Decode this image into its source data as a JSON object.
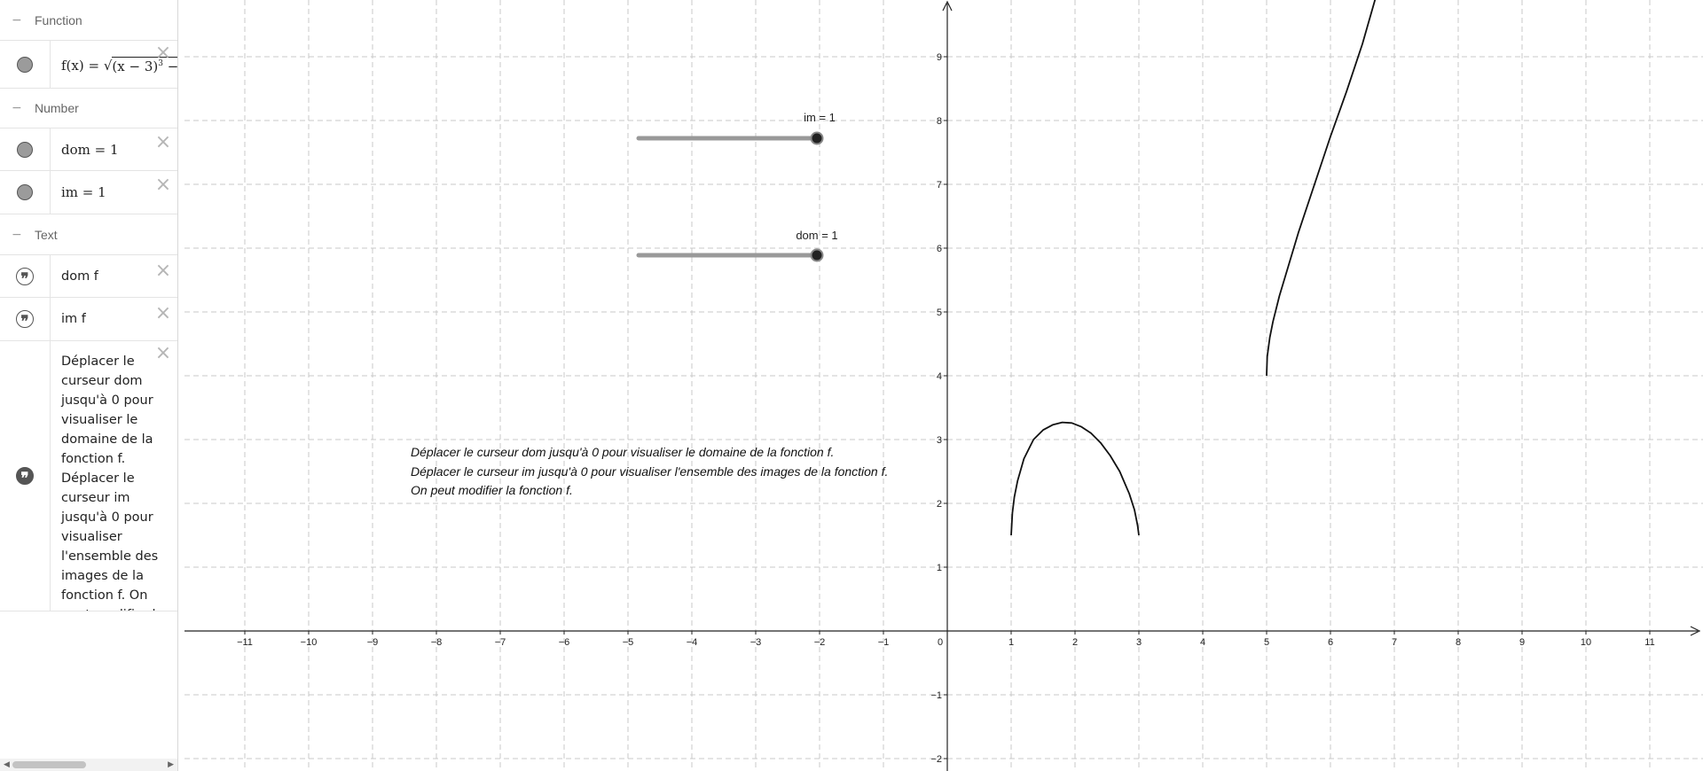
{
  "algebra": {
    "function_group": {
      "title": "Function",
      "expression": {
        "lhs": "f(x) =",
        "radicand": "(x − 3)",
        "exponent": "3",
        "tail": " − ..."
      }
    },
    "number_group": {
      "title": "Number",
      "dom": "dom = 1",
      "im": "im = 1"
    },
    "text_group": {
      "title": "Text",
      "dom_f": "dom f",
      "im_f": "im f",
      "instructions": "Déplacer le curseur dom jusqu'à 0 pour visualiser le domaine de la fonction f. Déplacer le curseur im jusqu'à 0 pour visualiser l'ensemble des images de la fonction f. On peut modifier la fonction f."
    },
    "delete_glyph": "×",
    "collapse_glyph": "−",
    "quote_glyph": "❞"
  },
  "graphics": {
    "slider_im": {
      "label": "im = 1",
      "value": 1,
      "min": 0,
      "max": 1
    },
    "slider_dom": {
      "label": "dom = 1",
      "value": 1,
      "min": 0,
      "max": 1
    },
    "instructions": [
      "Déplacer le curseur dom jusqu'à 0 pour visualiser le domaine de la fonction f.",
      "Déplacer le curseur im jusqu'à 0 pour visualiser l'ensemble des images de la fonction f.",
      "On peut modifier la fonction f."
    ]
  },
  "chart_data": {
    "type": "line",
    "xlim": [
      -12,
      12
    ],
    "ylim": [
      -2.15,
      9.9
    ],
    "x_ticks": [
      -11,
      -10,
      -9,
      -8,
      -7,
      -6,
      -5,
      -4,
      -3,
      -2,
      -1,
      0,
      1,
      2,
      3,
      4,
      5,
      6,
      7,
      8,
      9,
      10,
      11
    ],
    "y_ticks": [
      -2,
      -1,
      1,
      2,
      3,
      4,
      5,
      6,
      7,
      8,
      9
    ],
    "grid": true,
    "series": [
      {
        "x": [
          1.0,
          1.02,
          1.05,
          1.1,
          1.2,
          1.35,
          1.5,
          1.65,
          1.8,
          1.95,
          2.1,
          2.25,
          2.4,
          2.55,
          2.7,
          2.85,
          2.93,
          2.98,
          3.0
        ],
        "y": [
          1.5,
          1.85,
          2.1,
          2.35,
          2.7,
          3.0,
          3.15,
          3.23,
          3.27,
          3.26,
          3.2,
          3.1,
          2.95,
          2.75,
          2.5,
          2.15,
          1.9,
          1.65,
          1.5
        ]
      },
      {
        "x": [
          5.0,
          5.01,
          5.05,
          5.1,
          5.2,
          5.35,
          5.5,
          5.75,
          6.0,
          6.25,
          6.5,
          6.7
        ],
        "y": [
          4.0,
          4.3,
          4.6,
          4.85,
          5.25,
          5.75,
          6.25,
          7.0,
          7.75,
          8.45,
          9.2,
          9.9
        ]
      }
    ]
  }
}
